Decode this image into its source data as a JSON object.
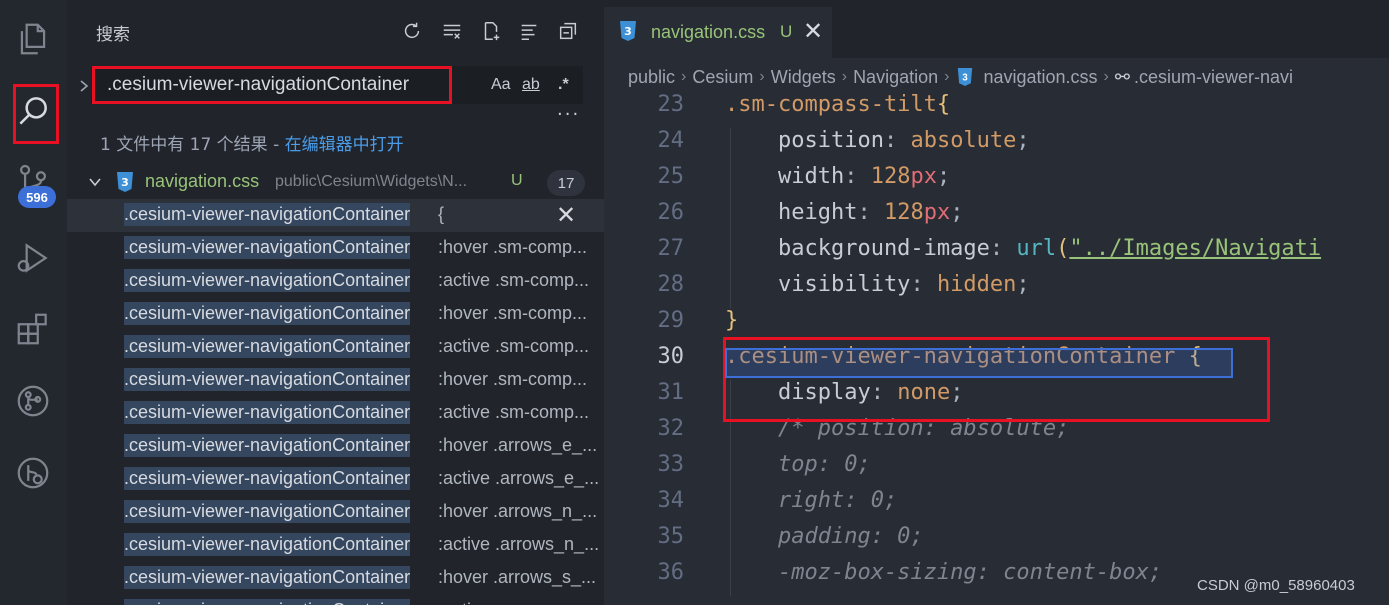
{
  "sidebar": {
    "title": "搜索",
    "search_value": ".cesium-viewer-navigationContainer",
    "options": {
      "case": "Aa",
      "word": "ab",
      "regex": ".*"
    },
    "more": "···",
    "summary_prefix": "1 文件中有 17 个结果 - ",
    "summary_link": "在编辑器中打开",
    "file": {
      "name": "navigation.css",
      "path": "public\\Cesium\\Widgets\\N...",
      "status": "U",
      "count": "17"
    },
    "results": [
      {
        "match": ".cesium-viewer-navigationContainer",
        "rest": " {",
        "selected": true
      },
      {
        "match": ".cesium-viewer-navigationContainer",
        "rest": ":hover .sm-comp..."
      },
      {
        "match": ".cesium-viewer-navigationContainer",
        "rest": ":active .sm-comp..."
      },
      {
        "match": ".cesium-viewer-navigationContainer",
        "rest": ":hover .sm-comp..."
      },
      {
        "match": ".cesium-viewer-navigationContainer",
        "rest": ":active .sm-comp..."
      },
      {
        "match": ".cesium-viewer-navigationContainer",
        "rest": ":hover .sm-comp..."
      },
      {
        "match": ".cesium-viewer-navigationContainer",
        "rest": ":active .sm-comp..."
      },
      {
        "match": ".cesium-viewer-navigationContainer",
        "rest": ":hover .arrows_e_..."
      },
      {
        "match": ".cesium-viewer-navigationContainer",
        "rest": ":active .arrows_e_..."
      },
      {
        "match": ".cesium-viewer-navigationContainer",
        "rest": ":hover .arrows_n_..."
      },
      {
        "match": ".cesium-viewer-navigationContainer",
        "rest": ":active .arrows_n_..."
      },
      {
        "match": ".cesium-viewer-navigationContainer",
        "rest": ":hover .arrows_s_..."
      },
      {
        "match": ".cesium-viewer-navigationContainer",
        "rest": ":active .arrows_s_..."
      }
    ]
  },
  "activity": {
    "scm_badge": "596"
  },
  "editor": {
    "tab": {
      "name": "navigation.css",
      "status": "U"
    },
    "breadcrumb": [
      "public",
      "Cesium",
      "Widgets",
      "Navigation",
      "navigation.css",
      ".cesium-viewer-navi"
    ],
    "lines": [
      {
        "n": "23",
        "t": [
          [
            "sel-tok",
            ".sm-compass-tilt"
          ],
          [
            "brace",
            "{"
          ]
        ]
      },
      {
        "n": "24",
        "t": [
          [
            "prop",
            "    position"
          ],
          [
            "pun",
            ": "
          ],
          [
            "val",
            "absolute"
          ],
          [
            "pun",
            ";"
          ]
        ]
      },
      {
        "n": "25",
        "t": [
          [
            "prop",
            "    width"
          ],
          [
            "pun",
            ": "
          ],
          [
            "num",
            "128"
          ],
          [
            "unit",
            "px"
          ],
          [
            "pun",
            ";"
          ]
        ]
      },
      {
        "n": "26",
        "t": [
          [
            "prop",
            "    height"
          ],
          [
            "pun",
            ": "
          ],
          [
            "num",
            "128"
          ],
          [
            "unit",
            "px"
          ],
          [
            "pun",
            ";"
          ]
        ]
      },
      {
        "n": "27",
        "t": [
          [
            "prop",
            "    background-image"
          ],
          [
            "pun",
            ": "
          ],
          [
            "fn",
            "url"
          ],
          [
            "brace",
            "("
          ],
          [
            "str",
            "\"../Images/Navigati"
          ]
        ]
      },
      {
        "n": "28",
        "t": [
          [
            "prop",
            "    visibility"
          ],
          [
            "pun",
            ": "
          ],
          [
            "val",
            "hidden"
          ],
          [
            "pun",
            ";"
          ]
        ]
      },
      {
        "n": "29",
        "t": [
          [
            "brace",
            "}"
          ]
        ]
      },
      {
        "n": "30",
        "t": [
          [
            "sel-tok",
            ".cesium-viewer-navigationContainer"
          ],
          [
            "pun",
            " "
          ],
          [
            "brace",
            "{"
          ]
        ]
      },
      {
        "n": "31",
        "t": [
          [
            "prop",
            "    display"
          ],
          [
            "pun",
            ": "
          ],
          [
            "val",
            "none"
          ],
          [
            "pun",
            ";"
          ]
        ]
      },
      {
        "n": "32",
        "t": [
          [
            "cmt",
            "    /* position: absolute;"
          ]
        ]
      },
      {
        "n": "33",
        "t": [
          [
            "cmt",
            "    top: 0;"
          ]
        ]
      },
      {
        "n": "34",
        "t": [
          [
            "cmt",
            "    right: 0;"
          ]
        ]
      },
      {
        "n": "35",
        "t": [
          [
            "cmt",
            "    padding: 0;"
          ]
        ]
      },
      {
        "n": "36",
        "t": [
          [
            "cmt",
            "    -moz-box-sizing: content-box;"
          ]
        ]
      }
    ],
    "current_line": "30"
  },
  "watermark": "CSDN @m0_58960403"
}
